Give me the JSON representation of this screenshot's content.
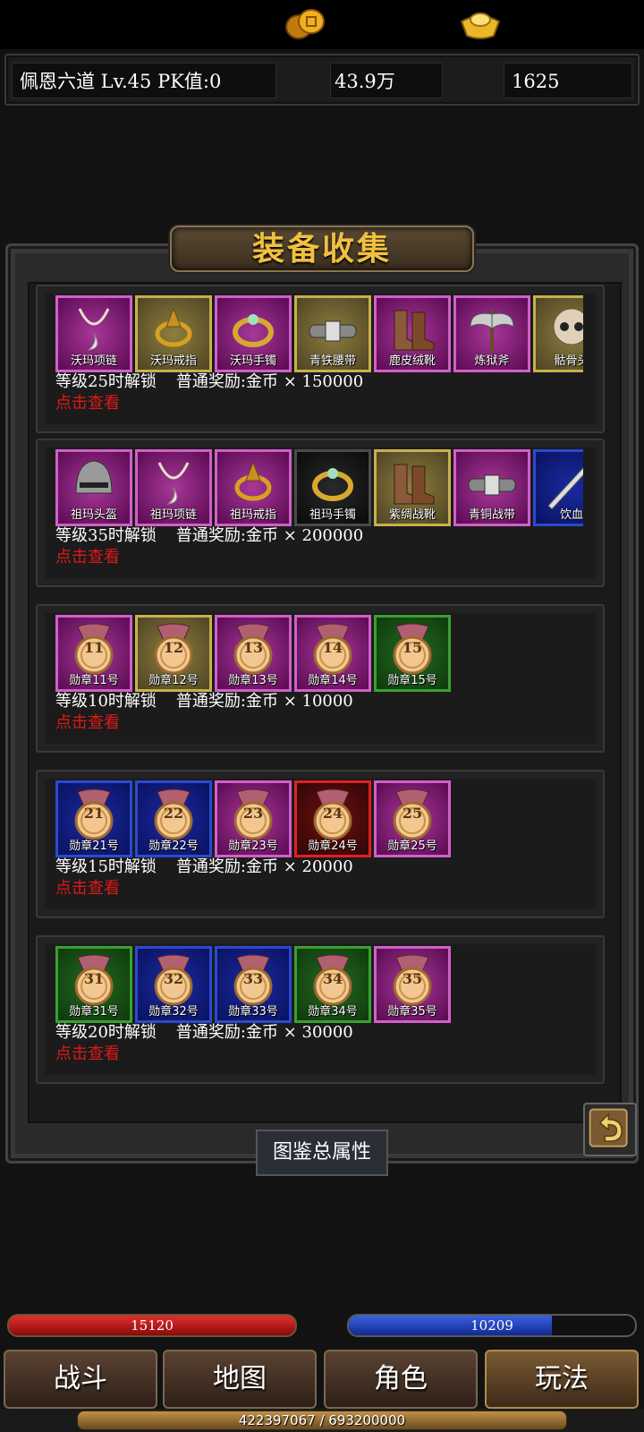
{
  "status": {
    "player": "佩恩六道  Lv.45 PK值:0",
    "gold": "43.9万",
    "ingot": "1625"
  },
  "panel": {
    "title": "装备收集",
    "total_button": "图鉴总属性"
  },
  "rows": [
    {
      "items": [
        {
          "label": "沃玛项链",
          "rarity": "purple",
          "icon": "necklace-icon"
        },
        {
          "label": "沃玛戒指",
          "rarity": "gold",
          "icon": "ring-icon"
        },
        {
          "label": "沃玛手镯",
          "rarity": "purple",
          "icon": "bracelet-icon"
        },
        {
          "label": "青铁腰带",
          "rarity": "gold",
          "icon": "belt-icon"
        },
        {
          "label": "鹿皮绒靴",
          "rarity": "purple",
          "icon": "boots-icon"
        },
        {
          "label": "炼狱斧",
          "rarity": "purple",
          "icon": "axe-icon"
        },
        {
          "label": "骷骨头",
          "rarity": "gold",
          "icon": "skull-helmet-icon"
        }
      ],
      "unlock": "等级25时解锁",
      "reward": "普通奖励:金币 × 150000",
      "view": "点击查看"
    },
    {
      "items": [
        {
          "label": "祖玛头盔",
          "rarity": "purple",
          "icon": "helmet-icon"
        },
        {
          "label": "祖玛项链",
          "rarity": "purple",
          "icon": "necklace-icon"
        },
        {
          "label": "祖玛戒指",
          "rarity": "purple",
          "icon": "ring-icon"
        },
        {
          "label": "祖玛手镯",
          "rarity": "black",
          "icon": "bracelet-icon"
        },
        {
          "label": "紫绸战靴",
          "rarity": "gold",
          "icon": "boots-icon"
        },
        {
          "label": "青铜战带",
          "rarity": "purple",
          "icon": "belt-icon"
        },
        {
          "label": "饮血",
          "rarity": "blue",
          "icon": "sword-icon"
        }
      ],
      "unlock": "等级35时解锁",
      "reward": "普通奖励:金币 × 200000",
      "view": "点击查看"
    },
    {
      "items": [
        {
          "label": "勋章11号",
          "num": "11",
          "rarity": "purple",
          "icon": "medal-icon"
        },
        {
          "label": "勋章12号",
          "num": "12",
          "rarity": "gold",
          "icon": "medal-icon"
        },
        {
          "label": "勋章13号",
          "num": "13",
          "rarity": "purple",
          "icon": "medal-icon"
        },
        {
          "label": "勋章14号",
          "num": "14",
          "rarity": "purple",
          "icon": "medal-icon"
        },
        {
          "label": "勋章15号",
          "num": "15",
          "rarity": "green",
          "icon": "medal-icon"
        }
      ],
      "unlock": "等级10时解锁",
      "reward": "普通奖励:金币 × 10000",
      "view": "点击查看"
    },
    {
      "items": [
        {
          "label": "勋章21号",
          "num": "21",
          "rarity": "blue",
          "icon": "medal-icon"
        },
        {
          "label": "勋章22号",
          "num": "22",
          "rarity": "blue",
          "icon": "medal-icon"
        },
        {
          "label": "勋章23号",
          "num": "23",
          "rarity": "purple",
          "icon": "medal-icon"
        },
        {
          "label": "勋章24号",
          "num": "24",
          "rarity": "red",
          "icon": "medal-icon"
        },
        {
          "label": "勋章25号",
          "num": "25",
          "rarity": "purple",
          "icon": "medal-icon"
        }
      ],
      "unlock": "等级15时解锁",
      "reward": "普通奖励:金币 × 20000",
      "view": "点击查看"
    },
    {
      "items": [
        {
          "label": "勋章31号",
          "num": "31",
          "rarity": "green",
          "icon": "medal-icon"
        },
        {
          "label": "勋章32号",
          "num": "32",
          "rarity": "blue",
          "icon": "medal-icon"
        },
        {
          "label": "勋章33号",
          "num": "33",
          "rarity": "blue",
          "icon": "medal-icon"
        },
        {
          "label": "勋章34号",
          "num": "34",
          "rarity": "green",
          "icon": "medal-icon"
        },
        {
          "label": "勋章35号",
          "num": "35",
          "rarity": "purple",
          "icon": "medal-icon"
        }
      ],
      "unlock": "等级20时解锁",
      "reward": "普通奖励:金币 × 30000",
      "view": "点击查看"
    }
  ],
  "bars": {
    "hp": "15120",
    "mp": "10209",
    "mp_fill_percent": 71,
    "exp": "422397067 / 693200000",
    "exp_fill_percent": 61
  },
  "nav": [
    "战斗",
    "地图",
    "角色",
    "玩法"
  ]
}
